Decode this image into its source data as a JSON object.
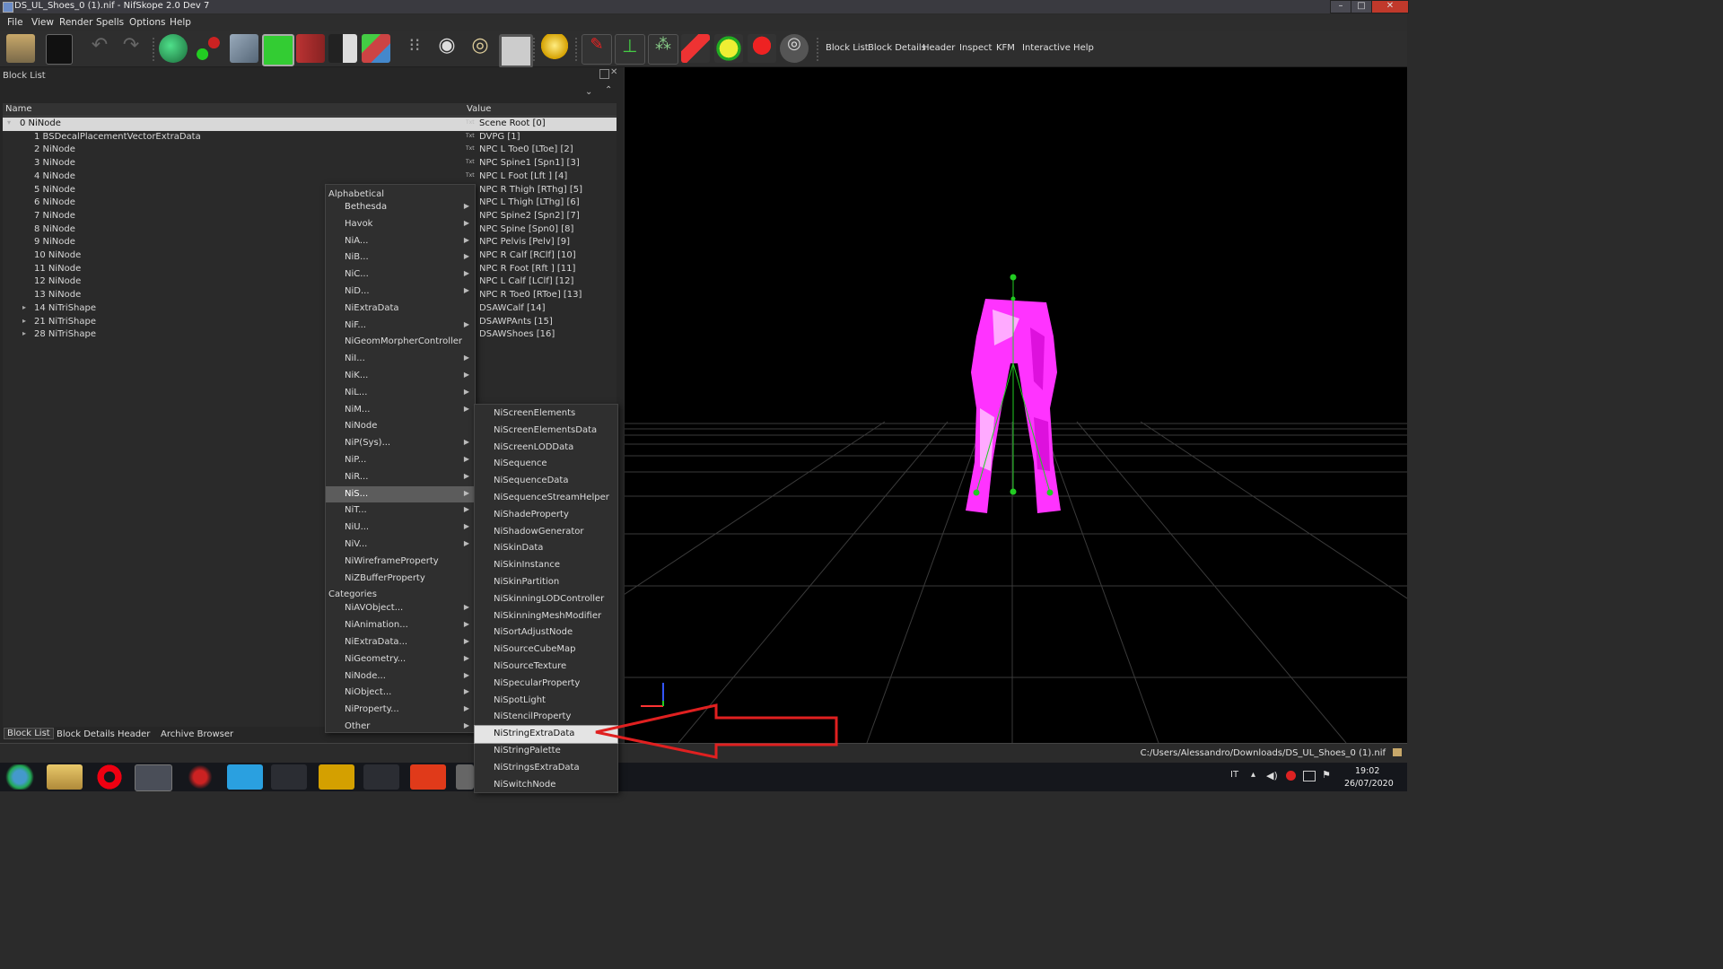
{
  "window": {
    "title": "DS_UL_Shoes_0 (1).nif - NifSkope 2.0 Dev 7",
    "controls": [
      "–",
      "□",
      "✕"
    ]
  },
  "menubar": [
    "File",
    "View",
    "Render",
    "Spells",
    "Options",
    "Help"
  ],
  "toolbar": {
    "icons": [
      "load-icon",
      "save-icon",
      "undo-icon",
      "redo-icon",
      "select-mesh-icon",
      "select-vertex-icon",
      "view-top-icon",
      "view-front-icon",
      "view-side-icon",
      "flip-view-icon",
      "perspective-cube-icon",
      "walk-mode-icon",
      "eye-icon",
      "hidden-eye-icon",
      "screenshot-icon",
      "light-bulb-icon",
      "show-axes-icon",
      "show-nodes-icon",
      "show-havok-icon",
      "show-constraints-icon",
      "show-markers-icon",
      "show-hidden-icon",
      "show-stencil-icon"
    ],
    "links": [
      "Block List",
      "Block Details",
      "Header",
      "Inspect",
      "KFM",
      "Interactive Help"
    ]
  },
  "block_list": {
    "title": "Block List",
    "columns": [
      "Name",
      "Value"
    ],
    "rows": [
      {
        "name": "0 NiNode",
        "value": "Scene Root [0]",
        "txt": true,
        "selected": true
      },
      {
        "name": "1 BSDecalPlacementVectorExtraData",
        "value": "DVPG [1]",
        "txt": true
      },
      {
        "name": "2 NiNode",
        "value": "NPC L Toe0 [LToe] [2]",
        "txt": true
      },
      {
        "name": "3 NiNode",
        "value": "NPC Spine1 [Spn1] [3]",
        "txt": true
      },
      {
        "name": "4 NiNode",
        "value": "NPC L Foot [Lft ] [4]",
        "txt": true
      },
      {
        "name": "5 NiNode",
        "value": "NPC R Thigh [RThg] [5]"
      },
      {
        "name": "6 NiNode",
        "value": "NPC L Thigh [LThg] [6]"
      },
      {
        "name": "7 NiNode",
        "value": "NPC Spine2 [Spn2] [7]"
      },
      {
        "name": "8 NiNode",
        "value": "NPC Spine [Spn0] [8]"
      },
      {
        "name": "9 NiNode",
        "value": "NPC Pelvis [Pelv] [9]"
      },
      {
        "name": "10 NiNode",
        "value": "NPC R Calf [RClf] [10]"
      },
      {
        "name": "11 NiNode",
        "value": "NPC R Foot [Rft ] [11]"
      },
      {
        "name": "12 NiNode",
        "value": "NPC L Calf [LClf] [12]"
      },
      {
        "name": "13 NiNode",
        "value": "NPC R Toe0 [RToe] [13]"
      },
      {
        "name": "14 NiTriShape",
        "value": "DSAWCalf [14]",
        "expandable": true
      },
      {
        "name": "21 NiTriShape",
        "value": "DSAWPAnts [15]",
        "expandable": true
      },
      {
        "name": "28 NiTriShape",
        "value": "DSAWShoes [16]",
        "expandable": true
      }
    ],
    "txt_badge": "Txt"
  },
  "bottom_tabs": [
    "Block List",
    "Block Details",
    "Header",
    "Archive Browser"
  ],
  "context_menu": {
    "sections": [
      {
        "header": "Alphabetical",
        "items": [
          {
            "label": "Bethesda",
            "sub": true
          },
          {
            "label": "Havok",
            "sub": true
          },
          {
            "label": "NiA...",
            "sub": true
          },
          {
            "label": "NiB...",
            "sub": true
          },
          {
            "label": "NiC...",
            "sub": true
          },
          {
            "label": "NiD...",
            "sub": true
          },
          {
            "label": "NiExtraData",
            "sub": false
          },
          {
            "label": "NiF...",
            "sub": true
          },
          {
            "label": "NiGeomMorpherController",
            "sub": false
          },
          {
            "label": "NiI...",
            "sub": true
          },
          {
            "label": "NiK...",
            "sub": true
          },
          {
            "label": "NiL...",
            "sub": true
          },
          {
            "label": "NiM...",
            "sub": true
          },
          {
            "label": "NiNode",
            "sub": false
          },
          {
            "label": "NiP(Sys)...",
            "sub": true
          },
          {
            "label": "NiP...",
            "sub": true
          },
          {
            "label": "NiR...",
            "sub": true
          },
          {
            "label": "NiS...",
            "sub": true,
            "highlighted": true
          },
          {
            "label": "NiT...",
            "sub": true
          },
          {
            "label": "NiU...",
            "sub": true
          },
          {
            "label": "NiV...",
            "sub": true
          },
          {
            "label": "NiWireframeProperty",
            "sub": false
          },
          {
            "label": "NiZBufferProperty",
            "sub": false
          }
        ]
      },
      {
        "header": "Categories",
        "items": [
          {
            "label": "NiAVObject...",
            "sub": true
          },
          {
            "label": "NiAnimation...",
            "sub": true
          },
          {
            "label": "NiExtraData...",
            "sub": true
          },
          {
            "label": "NiGeometry...",
            "sub": true
          },
          {
            "label": "NiNode...",
            "sub": true
          },
          {
            "label": "NiObject...",
            "sub": true
          },
          {
            "label": "NiProperty...",
            "sub": true
          },
          {
            "label": "Other",
            "sub": true
          }
        ]
      }
    ]
  },
  "submenu": {
    "items": [
      "NiScreenElements",
      "NiScreenElementsData",
      "NiScreenLODData",
      "NiSequence",
      "NiSequenceData",
      "NiSequenceStreamHelper",
      "NiShadeProperty",
      "NiShadowGenerator",
      "NiSkinData",
      "NiSkinInstance",
      "NiSkinPartition",
      "NiSkinningLODController",
      "NiSkinningMeshModifier",
      "NiSortAdjustNode",
      "NiSourceCubeMap",
      "NiSourceTexture",
      "NiSpecularProperty",
      "NiSpotLight",
      "NiStencilProperty",
      "NiStringExtraData",
      "NiStringPalette",
      "NiStringsExtraData",
      "NiSwitchNode"
    ],
    "highlighted": "NiStringExtraData"
  },
  "status": {
    "path": "C:/Users/Alessandro/Downloads/DS_UL_Shoes_0 (1).nif"
  },
  "taskbar": {
    "apps": [
      "start-orb-icon",
      "file-explorer-icon",
      "opera-icon",
      "media-app-icon",
      "spider-app-icon",
      "music-app-icon",
      "audio-app-icon",
      "folder-app-icon",
      "pointer-app-icon",
      "f-app-icon",
      "nifskope-icon"
    ],
    "language": "IT",
    "time": "19:02",
    "date": "26/07/2020"
  },
  "colors": {
    "mesh": "#ff33ff",
    "skeleton": "#22cc22",
    "arrow": "#e02020",
    "viewport_bg": "#000000",
    "grid": "#3c3c3c"
  }
}
